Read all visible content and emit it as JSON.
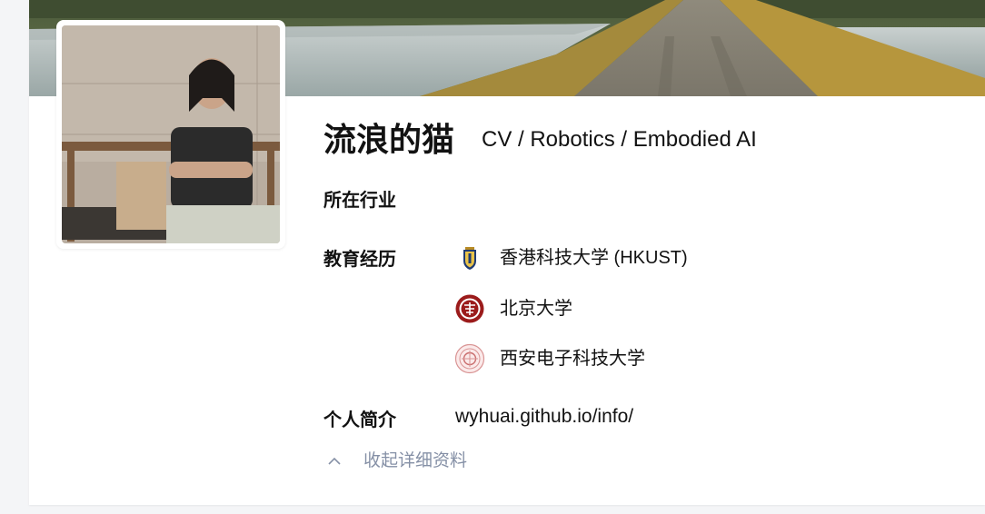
{
  "profile": {
    "name": "流浪的猫",
    "headline": "CV / Robotics / Embodied AI"
  },
  "details": {
    "industry_label": "所在行业",
    "education_label": "教育经历",
    "education": [
      {
        "school": "香港科技大学 (HKUST)",
        "logo_icon": "hkust-crest-icon"
      },
      {
        "school": "北京大学",
        "logo_icon": "pku-seal-icon"
      },
      {
        "school": "西安电子科技大学",
        "logo_icon": "xidian-seal-icon"
      }
    ],
    "bio_label": "个人简介",
    "bio_text": "wyhuai.github.io/info/"
  },
  "actions": {
    "collapse_label": "收起详细资料"
  },
  "colors": {
    "muted": "#8590a6",
    "text": "#121212"
  }
}
